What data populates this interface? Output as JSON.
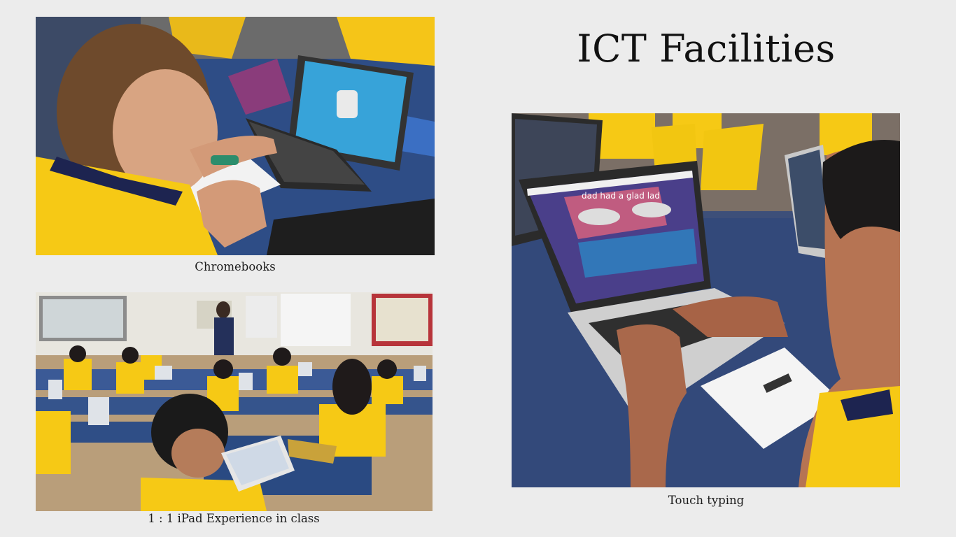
{
  "slide": {
    "title": "ICT Facilities"
  },
  "photos": [
    {
      "caption": "Chromebooks"
    },
    {
      "caption": "1 : 1 iPad Experience in class"
    },
    {
      "caption": "Touch typing"
    }
  ],
  "screen_text": {
    "typing_phrase": "dad had a glad lad"
  },
  "colors": {
    "background": "#ececec",
    "uniform_yellow": "#f6c915",
    "desk_blue": "#2c4a7e",
    "text": "#111111"
  }
}
